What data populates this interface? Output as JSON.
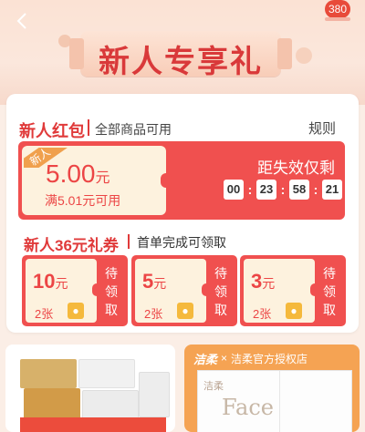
{
  "header": {
    "title": "新人专享礼",
    "badge_count": "380"
  },
  "new_red_packet": {
    "heading": "新人红包",
    "subheading": "全部商品可用",
    "rules_label": "规则",
    "tag": "新人",
    "amount": "5.00",
    "amount_unit": "元",
    "condition": "满5.01元可用",
    "expire_label": "距失效仅剩",
    "timer": [
      "00",
      "23",
      "58",
      "21"
    ]
  },
  "gift_coupons": {
    "heading": "新人36元礼券",
    "subheading": "首单完成可领取",
    "items": [
      {
        "amount": "10",
        "unit": "元",
        "qty": "2张",
        "claim": "待领取"
      },
      {
        "amount": "5",
        "unit": "元",
        "qty": "2张",
        "claim": "待领取"
      },
      {
        "amount": "3",
        "unit": "元",
        "qty": "2张",
        "claim": "待领取"
      }
    ]
  },
  "products": {
    "right_brand": "洁柔",
    "right_shop": "洁柔官方授权店",
    "right_pack_word": "Face",
    "right_pack_mark": "洁柔"
  },
  "colors": {
    "accent_red": "#f0504f",
    "coupon_bg": "#fdf2de",
    "tag_orange": "#f0a04d",
    "lock_yellow": "#f5b93c"
  }
}
